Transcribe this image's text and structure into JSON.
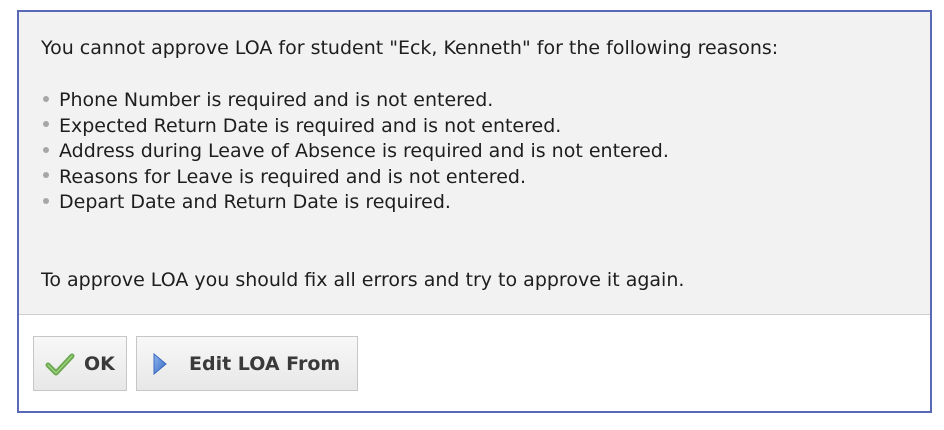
{
  "dialog": {
    "intro_text": "You cannot approve LOA for student \"Eck, Kenneth\" for the following reasons:",
    "reasons": [
      "Phone Number is required and is not entered.",
      "Expected Return Date is required and is not entered.",
      "Address during Leave of Absence is required and is not entered.",
      "Reasons for Leave is required and is not entered.",
      "Depart Date and Return Date is required."
    ],
    "outro_text": "To approve LOA you should fix all errors and try to approve it again."
  },
  "buttons": {
    "ok_label": "OK",
    "ok_icon": "checkmark-icon",
    "edit_label": "Edit LOA From",
    "edit_icon": "play-arrow-icon"
  },
  "colors": {
    "dialog_border": "#5a69b6",
    "message_background": "#f2f2f2",
    "check_green": "#6aa84f",
    "arrow_blue": "#4a7fd4"
  }
}
